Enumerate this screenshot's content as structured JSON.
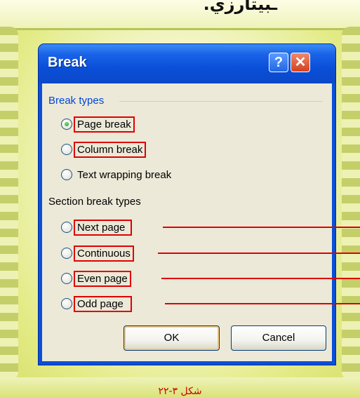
{
  "page": {
    "heading_arabic": "ـبيتارزي.",
    "caption": "شكل ٣-٢٢"
  },
  "dialog": {
    "title": "Break",
    "help_glyph": "?",
    "close_glyph": "✕",
    "break_types": {
      "label": "Break types",
      "options": [
        {
          "label": "Page break",
          "checked": true
        },
        {
          "label": "Column break",
          "checked": false
        },
        {
          "label": "Text wrapping break",
          "checked": false
        }
      ]
    },
    "section_break_types": {
      "label": "Section break types",
      "options": [
        {
          "label": "Next page",
          "checked": false
        },
        {
          "label": "Continuous",
          "checked": false
        },
        {
          "label": "Even page",
          "checked": false
        },
        {
          "label": "Odd page",
          "checked": false
        }
      ]
    },
    "buttons": {
      "ok": "OK",
      "cancel": "Cancel"
    }
  },
  "colors": {
    "highlight": "#e00000",
    "title_bar": "#0a4fd8",
    "dialog_bg": "#ece9d8"
  }
}
